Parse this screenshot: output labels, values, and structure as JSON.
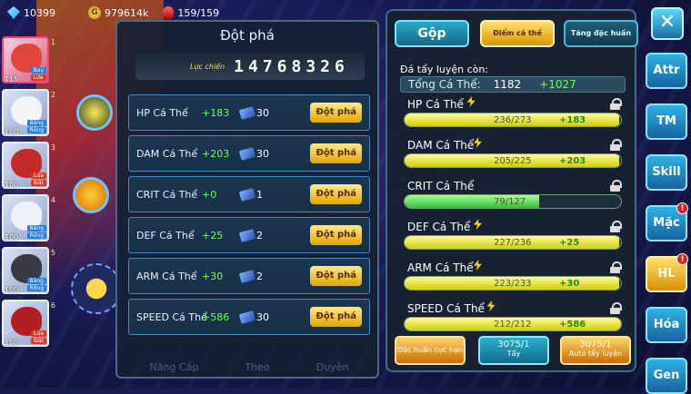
{
  "resources": {
    "gems": "10399",
    "gold": "979614k",
    "stamina": "159/159"
  },
  "team": [
    {
      "level": "115",
      "tags": [
        "Bay",
        "Lửa"
      ],
      "num": "1",
      "active": true,
      "color": "#e2453a"
    },
    {
      "level": "100",
      "tags": [
        "Băng",
        "Rồng"
      ],
      "num": "2",
      "active": false,
      "color": "#f2f4f8"
    },
    {
      "level": "100",
      "tags": [
        "Lửa",
        "Đất"
      ],
      "num": "3",
      "active": false,
      "color": "#c62a28"
    },
    {
      "level": "100",
      "tags": [
        "Băng",
        "Rồng"
      ],
      "num": "4",
      "active": false,
      "color": "#eef2f8"
    },
    {
      "level": "100",
      "tags": [
        "Băng",
        "Rồng"
      ],
      "num": "5",
      "active": false,
      "color": "#3a3a44"
    },
    {
      "level": "100",
      "tags": [
        "Lửa",
        "Đất"
      ],
      "num": "6",
      "active": false,
      "color": "#b02020"
    }
  ],
  "left_panel": {
    "title": "Đột phá",
    "power_label": "Lực chiến",
    "power_value": "14768326",
    "rows": [
      {
        "name": "HP Cá Thể",
        "bonus": "+183",
        "cost": "30",
        "button": "Đột phá"
      },
      {
        "name": "DAM Cá Thể",
        "bonus": "+203",
        "cost": "30",
        "button": "Đột phá"
      },
      {
        "name": "CRIT Cá Thể",
        "bonus": "+0",
        "cost": "1",
        "button": "Đột phá"
      },
      {
        "name": "DEF Cá Thể",
        "bonus": "+25",
        "cost": "2",
        "button": "Đột phá"
      },
      {
        "name": "ARM Cá Thể",
        "bonus": "+30",
        "cost": "2",
        "button": "Đột phá"
      },
      {
        "name": "SPEED Cá Thể",
        "bonus": "+586",
        "cost": "30",
        "button": "Đột phá"
      }
    ],
    "faded_bottom": [
      "Nâng Cấp",
      "Theo",
      "Duyên"
    ]
  },
  "right_panel": {
    "tabs": [
      "Gộp",
      "Điểm cá thể",
      "Tăng đặc huấn"
    ],
    "remain_label": "Đá tẩy luyện còn:",
    "total": {
      "label": "Tổng Cá Thể:",
      "value": "1182",
      "add": "+1027"
    },
    "stats": [
      {
        "name": "HP Cá Thể",
        "current": "236/273",
        "add": "+183",
        "fill": 0.99,
        "bar": "yellow",
        "bolt": true
      },
      {
        "name": "DAM Cá Thể",
        "current": "205/225",
        "add": "+203",
        "fill": 0.99,
        "bar": "yellow",
        "bolt": true
      },
      {
        "name": "CRIT Cá Thể",
        "current": "79/127",
        "add": "",
        "fill": 0.62,
        "bar": "green",
        "bolt": false
      },
      {
        "name": "DEF Cá Thể",
        "current": "227/236",
        "add": "+25",
        "fill": 0.99,
        "bar": "yellow",
        "bolt": true
      },
      {
        "name": "ARM Cá Thể",
        "current": "223/233",
        "add": "+30",
        "fill": 0.99,
        "bar": "yellow",
        "bolt": true
      },
      {
        "name": "SPEED Cá Thể",
        "current": "212/212",
        "add": "+586",
        "fill": 1.0,
        "bar": "yellow",
        "bolt": true
      }
    ],
    "actions": [
      {
        "label": "Đặc huấn cực hạn",
        "count": ""
      },
      {
        "label": "Tẩy",
        "count": "3075/1"
      },
      {
        "label": "Auto tẩy luyện",
        "count": "3075/1"
      }
    ]
  },
  "menu": {
    "close": "✕",
    "items": [
      {
        "label": "Attr",
        "badge": "",
        "active": false
      },
      {
        "label": "TM",
        "badge": "",
        "active": false
      },
      {
        "label": "Skill",
        "badge": "",
        "active": false
      },
      {
        "label": "Mặc",
        "badge": "!",
        "active": false
      },
      {
        "label": "HL",
        "badge": "!",
        "active": true
      },
      {
        "label": "Hóa",
        "badge": "",
        "active": false
      },
      {
        "label": "Gen",
        "badge": "",
        "active": false
      }
    ]
  }
}
